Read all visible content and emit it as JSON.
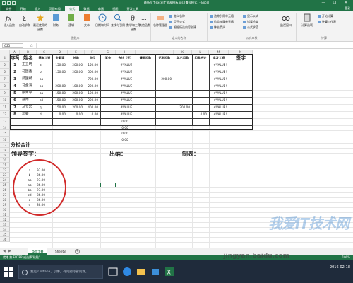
{
  "window": {
    "title": "最新员工excel工资表模板.xls [兼容模式] - Excel",
    "controls": [
      "—",
      "❐",
      "✕"
    ]
  },
  "ribbon_tabs": [
    "文件",
    "开始",
    "插入",
    "页面布局",
    "公式",
    "数据",
    "审阅",
    "视图",
    "开发工具"
  ],
  "active_tab": "公式",
  "ribbon_right": "登录",
  "ribbon": {
    "groups": [
      {
        "label": "函数库",
        "buttons": [
          "插入函数",
          "自动求和",
          "最近使用的函数",
          "财务",
          "逻辑",
          "文本",
          "日期和时间",
          "查找与引用",
          "数学和三角函数",
          "其他函数"
        ]
      },
      {
        "label": "定义的名称",
        "buttons": [
          "名称管理器"
        ],
        "small": [
          "定义名称",
          "用于公式",
          "根据所选内容创建"
        ]
      },
      {
        "label": "公式审核",
        "small": [
          "追踪引用单元格",
          "追踪从属单元格",
          "移去箭头",
          "显示公式",
          "错误检查",
          "公式求值"
        ],
        "buttons": [
          "监视窗口"
        ]
      },
      {
        "label": "计算",
        "buttons": [
          "计算选项"
        ],
        "small": [
          "开始计算",
          "计算工作表"
        ]
      }
    ]
  },
  "formula_bar": {
    "name_box": "G25",
    "fx": "fx",
    "value": ""
  },
  "columns": [
    "A",
    "B",
    "C",
    "D",
    "E",
    "F",
    "G",
    "H",
    "I",
    "J",
    "K",
    "L",
    "M",
    "N"
  ],
  "rows": [
    "4",
    "5",
    "6",
    "7",
    "8",
    "9",
    "10",
    "11",
    "12",
    "13",
    "14",
    "15",
    "16",
    "17",
    "18",
    "19",
    "20",
    "21",
    "22",
    "23",
    "24",
    "25",
    "26",
    "27",
    "28",
    "29",
    "30",
    "31",
    "32",
    "33",
    "34",
    "35",
    "36"
  ],
  "table": {
    "headers": {
      "seq": "序号",
      "name": "姓名",
      "base": "基本工资",
      "fulltime": "全勤奖",
      "subsidy": "补助",
      "post": "岗位",
      "bonus": "奖金",
      "total": "合计（元）",
      "leave": "请假扣款（元）",
      "late": "迟到扣款（元）",
      "other": "其它扣款（元）",
      "deduct": "扣款合计（元）",
      "actual": "实发工资（元）",
      "sign": "签字"
    },
    "rows": [
      {
        "seq": "1",
        "name": "王卫明",
        "base": "a",
        "fulltime": "150.00",
        "subsidy": "200.00",
        "post": "150.00",
        "bonus": "",
        "total": "#VALUE!",
        "leave": "",
        "late": "",
        "other": "",
        "deduct": "",
        "actual": "#VALUE!"
      },
      {
        "seq": "2",
        "name": "马国鑫",
        "base": "b",
        "fulltime": "150.00",
        "subsidy": "200.00",
        "post": "500.00",
        "bonus": "",
        "total": "#VALUE!",
        "leave": "",
        "late": "",
        "other": "",
        "deduct": "",
        "actual": "#VALUE!"
      },
      {
        "seq": "3",
        "name": "郑国斌",
        "base": "aa",
        "fulltime": "",
        "subsidy": "",
        "post": "700.00",
        "bonus": "",
        "total": "#VALUE!",
        "leave": "",
        "late": "200.00",
        "other": "",
        "deduct": "",
        "actual": "#VALUE!"
      },
      {
        "seq": "4",
        "name": "马金海",
        "base": "ab",
        "fulltime": "200.00",
        "subsidy": "100.00",
        "post": "200.00",
        "bonus": "",
        "total": "#VALUE!",
        "leave": "",
        "late": "",
        "other": "",
        "deduct": "",
        "actual": "#VALUE!"
      },
      {
        "seq": "5",
        "name": "张青琴",
        "base": "ba",
        "fulltime": "150.00",
        "subsidy": "200.00",
        "post": "100.00",
        "bonus": "",
        "total": "#VALUE!",
        "leave": "",
        "late": "",
        "other": "",
        "deduct": "",
        "actual": "#VALUE!"
      },
      {
        "seq": "6",
        "name": "聂闯",
        "base": "cd",
        "fulltime": "150.00",
        "subsidy": "200.00",
        "post": "200.00",
        "bonus": "",
        "total": "#VALUE!",
        "leave": "",
        "late": "",
        "other": "",
        "deduct": "",
        "actual": "#VALUE!"
      },
      {
        "seq": "7",
        "name": "马立宏",
        "base": "q",
        "fulltime": "150.00",
        "subsidy": "200.00",
        "post": "400.00",
        "bonus": "",
        "total": "#VALUE!",
        "leave": "",
        "late": "",
        "other": "200.00",
        "deduct": "",
        "actual": "#VALUE!"
      },
      {
        "seq": "8",
        "name": "邓睿",
        "base": "d",
        "fulltime": "0.00",
        "subsidy": "0.00",
        "post": "0.00",
        "bonus": "",
        "total": "#VALUE!",
        "leave": "",
        "late": "",
        "other": "",
        "deduct": "0.00",
        "actual": "#VALUE!"
      }
    ],
    "extra_totals": [
      "0.00",
      "0.00",
      "0.00",
      "0.00"
    ],
    "subtotal_label": "分栏合计"
  },
  "signatures": {
    "leader": "领导签字：",
    "cashier": "出纳：",
    "maker": "制表："
  },
  "side_list": [
    {
      "key": "a",
      "value": "97.00"
    },
    {
      "key": "b",
      "value": "86.00"
    },
    {
      "key": "aa",
      "value": "97.00"
    },
    {
      "key": "ab",
      "value": "86.00"
    },
    {
      "key": "ba",
      "value": "97.00"
    },
    {
      "key": "cd",
      "value": "86.00"
    },
    {
      "key": "q",
      "value": "86.00"
    },
    {
      "key": "d",
      "value": "86.00"
    }
  ],
  "sheets": [
    {
      "label": "5月工资",
      "active": true
    },
    {
      "label": "Sheet3",
      "active": false
    }
  ],
  "status": {
    "text": "就绪 按 ENTER 或选择\"粘贴\"",
    "zoom": "100%"
  },
  "taskbar": {
    "search_placeholder": "我是 Cortana，小娜。有问题尽管问我。",
    "time": "2016-02-18"
  },
  "watermark": {
    "brand": "我爱IT技术网",
    "url": "jingyan.baidu.com"
  },
  "colors": {
    "accent": "#217346",
    "circle": "#d12b2b"
  }
}
